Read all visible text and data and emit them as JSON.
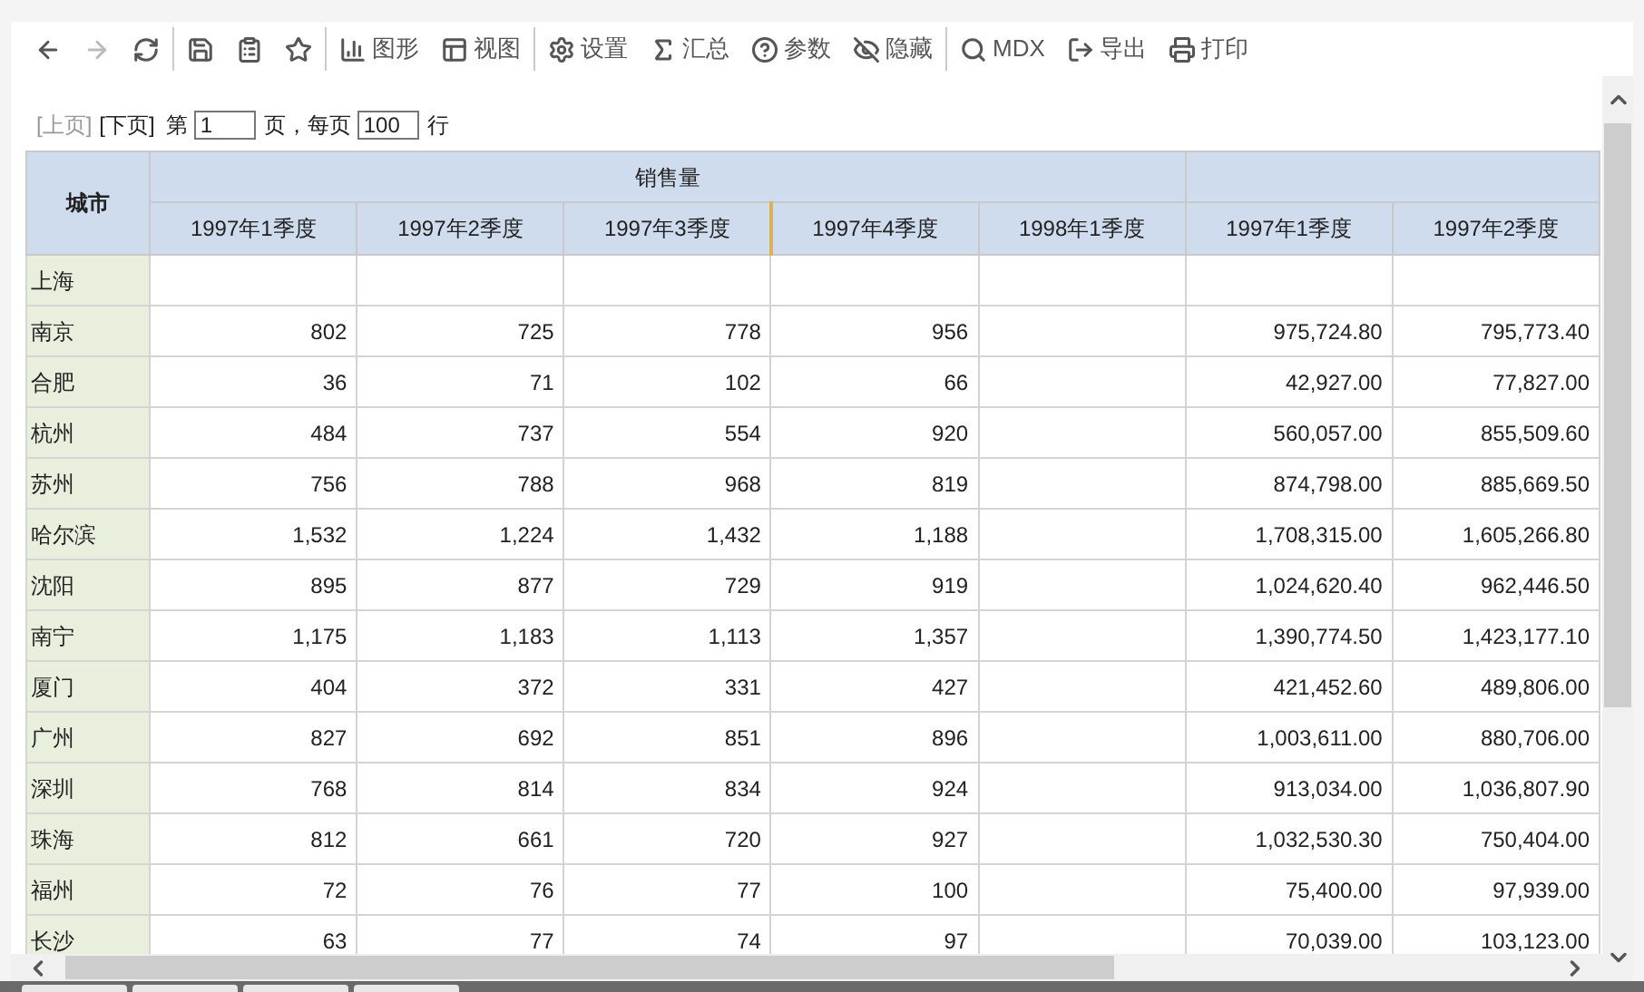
{
  "toolbar": {
    "groups": [
      [
        {
          "disabled": false
        },
        {
          "disabled": true
        },
        {
          "disabled": false
        }
      ],
      [
        {
          "disabled": false
        },
        {
          "disabled": false
        },
        {
          "disabled": false
        }
      ],
      [
        {
          "label": "图形",
          "disabled": false
        },
        {
          "label": "视图",
          "disabled": false
        }
      ],
      [
        {
          "label": "设置",
          "disabled": false
        },
        {
          "label": "汇总",
          "disabled": false
        },
        {
          "label": "参数",
          "disabled": false
        },
        {
          "label": "隐藏",
          "disabled": false
        }
      ],
      [
        {
          "label": "MDX",
          "disabled": false
        },
        {
          "label": "导出",
          "disabled": false
        },
        {
          "label": "打印",
          "disabled": false
        }
      ]
    ]
  },
  "pager": {
    "prev": {
      "label": "[上页]",
      "disabled": true
    },
    "next": {
      "label": "[下页]",
      "disabled": false
    },
    "page_prefix": "第",
    "page": "1",
    "per_page_label": "页，每页",
    "per_page": "100",
    "rows_suffix": "行"
  },
  "table": {
    "row_header": "城市",
    "groups": [
      {
        "label": "销售量",
        "columns": [
          "1997年1季度",
          "1997年2季度",
          "1997年3季度",
          "1997年4季度",
          "1998年1季度"
        ]
      },
      {
        "columns": [
          "1997年1季度",
          "1997年2季度"
        ]
      }
    ],
    "rows": [
      {
        "city": "上海",
        "cells": [
          {},
          {},
          {},
          {},
          {},
          {},
          {}
        ]
      },
      {
        "city": "南京",
        "cells": [
          {
            "text": "802"
          },
          {
            "text": "725"
          },
          {
            "text": "778"
          },
          {
            "text": "956"
          },
          {},
          {
            "text": "975,724.80"
          },
          {
            "text": "795,773.40"
          }
        ]
      },
      {
        "city": "合肥",
        "cells": [
          {
            "text": "36"
          },
          {
            "text": "71"
          },
          {
            "text": "102"
          },
          {
            "text": "66"
          },
          {},
          {
            "text": "42,927.00"
          },
          {
            "text": "77,827.00"
          }
        ]
      },
      {
        "city": "杭州",
        "cells": [
          {
            "text": "484"
          },
          {
            "text": "737"
          },
          {
            "text": "554"
          },
          {
            "text": "920"
          },
          {},
          {
            "text": "560,057.00"
          },
          {
            "text": "855,509.60"
          }
        ]
      },
      {
        "city": "苏州",
        "cells": [
          {
            "text": "756"
          },
          {
            "text": "788"
          },
          {
            "text": "968"
          },
          {
            "text": "819"
          },
          {},
          {
            "text": "874,798.00"
          },
          {
            "text": "885,669.50"
          }
        ]
      },
      {
        "city": "哈尔滨",
        "cells": [
          {
            "text": "1,532"
          },
          {
            "text": "1,224"
          },
          {
            "text": "1,432"
          },
          {
            "text": "1,188"
          },
          {},
          {
            "text": "1,708,315.00"
          },
          {
            "text": "1,605,266.80"
          }
        ]
      },
      {
        "city": "沈阳",
        "cells": [
          {
            "text": "895"
          },
          {
            "text": "877"
          },
          {
            "text": "729"
          },
          {
            "text": "919"
          },
          {},
          {
            "text": "1,024,620.40"
          },
          {
            "text": "962,446.50"
          }
        ]
      },
      {
        "city": "南宁",
        "cells": [
          {
            "text": "1,175"
          },
          {
            "text": "1,183"
          },
          {
            "text": "1,113"
          },
          {
            "text": "1,357"
          },
          {},
          {
            "text": "1,390,774.50"
          },
          {
            "text": "1,423,177.10"
          }
        ]
      },
      {
        "city": "厦门",
        "cells": [
          {
            "text": "404"
          },
          {
            "text": "372"
          },
          {
            "text": "331"
          },
          {
            "text": "427"
          },
          {},
          {
            "text": "421,452.60"
          },
          {
            "text": "489,806.00"
          }
        ]
      },
      {
        "city": "广州",
        "cells": [
          {
            "text": "827"
          },
          {
            "text": "692"
          },
          {
            "text": "851"
          },
          {
            "text": "896"
          },
          {},
          {
            "text": "1,003,611.00"
          },
          {
            "text": "880,706.00"
          }
        ]
      },
      {
        "city": "深圳",
        "cells": [
          {
            "text": "768"
          },
          {
            "text": "814"
          },
          {
            "text": "834"
          },
          {
            "text": "924"
          },
          {},
          {
            "text": "913,034.00"
          },
          {
            "text": "1,036,807.90"
          }
        ]
      },
      {
        "city": "珠海",
        "cells": [
          {
            "text": "812"
          },
          {
            "text": "661"
          },
          {
            "text": "720"
          },
          {
            "text": "927"
          },
          {},
          {
            "text": "1,032,530.30"
          },
          {
            "text": "750,404.00"
          }
        ]
      },
      {
        "city": "福州",
        "cells": [
          {
            "text": "72"
          },
          {
            "text": "76"
          },
          {
            "text": "77"
          },
          {
            "text": "100"
          },
          {},
          {
            "text": "75,400.00"
          },
          {
            "text": "97,939.00"
          }
        ]
      },
      {
        "city": "长沙",
        "cells": [
          {
            "text": "63"
          },
          {
            "text": "77"
          },
          {
            "text": "74"
          },
          {
            "text": "97"
          },
          {},
          {
            "text": "70,039.00"
          },
          {
            "text": "103,123.00"
          }
        ]
      }
    ]
  }
}
